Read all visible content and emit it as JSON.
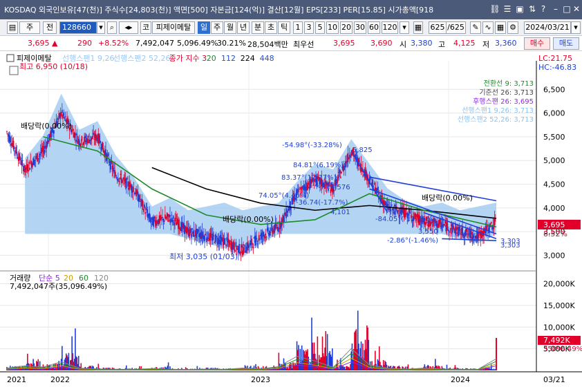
{
  "window": {
    "title": "KOSDAQ 외국인보유[47(천)] 주식수[24,803(천)] 액면[500] 자본금[124(억)] 결산[12월] EPS[233] PER[15.85] 시가총액[918"
  },
  "toolbar": {
    "type_label": "주",
    "period_label": "전",
    "stock_code": "128660",
    "stock_name": "피제이메탈",
    "stock_prefix": "코",
    "tabs": [
      "일",
      "주",
      "월",
      "년",
      "분",
      "초",
      "틱"
    ],
    "selected_tab": "일",
    "numbers": [
      "1",
      "3",
      "5",
      "10",
      "20",
      "30",
      "60",
      "120"
    ],
    "count_value": "625",
    "count_total": "/625",
    "date": "2024/03/21"
  },
  "quote": {
    "price": "3,695",
    "change": "290",
    "change_pct": "+8.52%",
    "volume": "7,492,047",
    "volume_pct": "5,096.49%",
    "turnover": "30.21%",
    "amount": "28,504백만",
    "last_label": "최우선",
    "ask": "3,695",
    "bid": "3,690",
    "open_label": "시",
    "open": "3,380",
    "high_label": "고",
    "high": "4,125",
    "low_label": "저",
    "low": "3,360",
    "buy_label": "매수",
    "sell_label": "매도"
  },
  "colors": {
    "up": "#e0002a",
    "down": "#1d3fd8",
    "cloud": "#a7cdf2",
    "ma_black": "#000000",
    "ma_green": "#1d8a28",
    "ma_blue": "#2250c8",
    "ma_purple": "#8a2be2"
  },
  "legend_price": {
    "name": "피제이메탈",
    "items": [
      "선행스팬1 9,26",
      "선행스팬2 52,26",
      "종가 지수 3",
      "20",
      "112",
      "224",
      "448"
    ],
    "item_colors": [
      "#9fc7f0",
      "#9fc7f0",
      "#e0002a",
      "#1d8a28",
      "#2250c8",
      "#000000",
      "#2250c8"
    ]
  },
  "legend_volume": {
    "name": "거래량",
    "items": [
      "단순 5",
      "20",
      "60",
      "120"
    ],
    "item_colors": [
      "#8a2be2",
      "#c8a000",
      "#1d8a28",
      "#888888"
    ],
    "value": "7,492,047주(35,096.49%)"
  },
  "ichimoku_values": {
    "conversion": "전환선 9: 3,713",
    "base": "기준선 26: 3,713",
    "lagging": "후행스팬 26: 3,695",
    "leading1": "선행스팬1 9,26: 3,713",
    "leading2": "선행스팬2 52,26: 3,713"
  },
  "indicators": {
    "lc": "LC:21.75",
    "hc": "HC:-46.83"
  },
  "annotations": {
    "max": "최고 6,950 (10/18)",
    "min": "최저 3,035 (01/03)",
    "div1": "배당락(0.00%)",
    "div2": "배당락(0.00%)",
    "div3": "배당락(0.00%)",
    "ann1": "-54.98°(-33.28%)",
    "ann2": "5,825",
    "ann3": "84.81°(6.19%)",
    "ann4": "83.37°(12.77%)",
    "ann5": "4,495",
    "ann6": "-36.74(-17.7%)",
    "ann7": "4,576",
    "ann8": "74.05°(4.46%)",
    "ann9": "4,101",
    "ann10": "-84.05°(-13.75%)",
    "ann11": "3,550",
    "ann12": "-2.86°(-1.46%)",
    "ann13": "3,303",
    "ann14": "3,303"
  },
  "price_tags": {
    "price": "3,695",
    "pct": "8.52%"
  },
  "volume_tags": {
    "value": "7,492K",
    "pct": "35096.49%"
  },
  "x_axis": {
    "labels": [
      "2021",
      "2022",
      "2023",
      "2024",
      "03/21"
    ]
  },
  "chart_data": [
    {
      "type": "candlestick",
      "title": "피제이메탈",
      "ylim": [
        2700,
        7000
      ],
      "y_ticks": [
        3000,
        3500,
        4000,
        4500,
        5000,
        5500,
        6000,
        6500
      ],
      "series": [
        {
          "name": "종가",
          "x": [
            "2021-12",
            "2022-01",
            "2022-02",
            "2022-03",
            "2022-04",
            "2022-05",
            "2022-06",
            "2022-07",
            "2022-08",
            "2022-09",
            "2022-10",
            "2022-11",
            "2022-12",
            "2023-01",
            "2023-02",
            "2023-03",
            "2023-04",
            "2023-05",
            "2023-06",
            "2023-07",
            "2023-08",
            "2023-09",
            "2023-10",
            "2023-11",
            "2023-12",
            "2024-01",
            "2024-02",
            "2024-03"
          ],
          "values": [
            5600,
            4800,
            5200,
            6000,
            5400,
            5500,
            4700,
            4400,
            3700,
            3800,
            3500,
            3400,
            3300,
            3100,
            3400,
            3600,
            4300,
            4600,
            4400,
            5200,
            4600,
            4000,
            3900,
            3700,
            3650,
            3500,
            3400,
            3695
          ]
        },
        {
          "name": "224",
          "x": [
            "2022-08",
            "2022-11",
            "2023-02",
            "2023-05",
            "2023-08",
            "2023-11",
            "2024-03"
          ],
          "values": [
            4850,
            4400,
            4100,
            3950,
            4050,
            3950,
            3780
          ]
        },
        {
          "name": "112",
          "x": [
            "2022-02",
            "2022-05",
            "2022-08",
            "2022-11",
            "2023-02",
            "2023-05",
            "2023-08",
            "2023-11",
            "2024-03"
          ],
          "values": [
            5500,
            5200,
            4400,
            3850,
            3650,
            3750,
            4300,
            3950,
            3600
          ]
        }
      ],
      "price_extremes": {
        "max": 6950,
        "max_date": "10/18",
        "min": 3035,
        "min_date": "01/03"
      }
    },
    {
      "type": "bar",
      "title": "거래량",
      "ylim": [
        0,
        22000
      ],
      "y_ticks": [
        5000,
        10000,
        15000,
        20000
      ],
      "y_tick_labels": [
        "5,000K",
        "10,000K",
        "15,000K",
        "20,000K"
      ],
      "latest_value_k": 7492,
      "x": [
        "2021-12",
        "2022-01",
        "2022-02",
        "2022-03",
        "2022-04",
        "2022-05",
        "2022-06",
        "2022-07",
        "2022-08",
        "2022-09",
        "2022-10",
        "2022-11",
        "2022-12",
        "2023-01",
        "2023-02",
        "2023-03",
        "2023-04",
        "2023-05",
        "2023-06",
        "2023-07",
        "2023-08",
        "2023-09",
        "2023-10",
        "2023-11",
        "2023-12",
        "2024-01",
        "2024-02",
        "2024-03"
      ],
      "values": [
        1500,
        3000,
        2200,
        5500,
        1500,
        900,
        800,
        700,
        1200,
        800,
        600,
        900,
        700,
        1500,
        1000,
        2500,
        9000,
        6000,
        2000,
        14000,
        3500,
        1500,
        800,
        1500,
        900,
        700,
        800,
        7492
      ]
    }
  ]
}
